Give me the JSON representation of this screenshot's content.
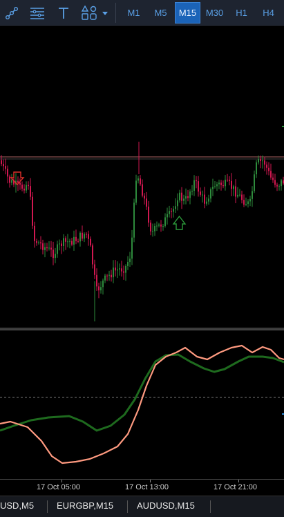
{
  "toolbar": {
    "tools": [
      {
        "name": "trendline-tool-icon"
      },
      {
        "name": "lines-tool-icon"
      },
      {
        "name": "text-tool-icon"
      },
      {
        "name": "shapes-tool-icon"
      }
    ],
    "timeframes": [
      "M1",
      "M5",
      "M15",
      "M30",
      "H1",
      "H4"
    ],
    "active_timeframe": "M15"
  },
  "chart_data": {
    "type": "candlestick",
    "colors": {
      "bull": "#2e8b3c",
      "bear": "#d01850",
      "wick": "#b0b0b0",
      "level": "#d88080"
    },
    "signals": [
      {
        "kind": "sell-arrow",
        "color": "#e0302a"
      },
      {
        "kind": "buy-arrow",
        "color": "#2c9a3a"
      }
    ],
    "indicator": {
      "series": [
        {
          "color": "#ff9a80"
        },
        {
          "color": "#1e6a1e"
        }
      ],
      "level_color": "#777777"
    },
    "time_labels": [
      "17 Oct 05:00",
      "17 Oct 13:00",
      "17 Oct 21:00"
    ]
  },
  "tabs": [
    "USD,M5",
    "EURGBP,M15",
    "AUDUSD,M15"
  ]
}
